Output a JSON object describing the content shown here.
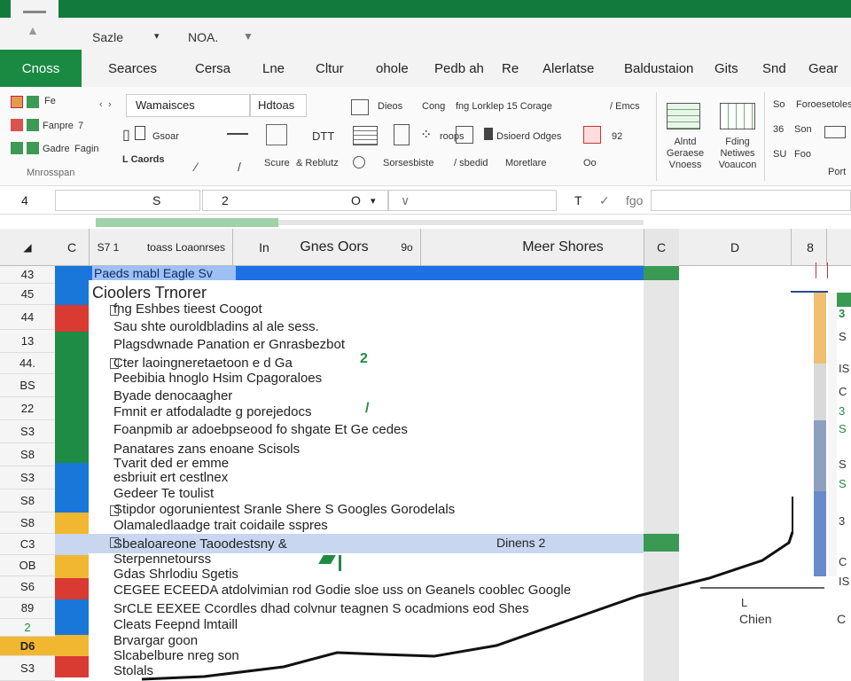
{
  "quick_access": {
    "item1": "Sazle",
    "item2": "NOA."
  },
  "tabs": {
    "active": "Cnoss",
    "items": [
      "Searces",
      "Cersa",
      "Lne",
      "Cltur",
      "ohole",
      "Pedb ah",
      "Re",
      "Alerlatse",
      "Baldustaion",
      "Gits",
      "Snd",
      "Gear"
    ]
  },
  "ribbon": {
    "g1": [
      "Fe",
      "Fanpre",
      "Gadre"
    ],
    "g1_caption": "Mnrosspan",
    "g1b": [
      "7",
      "Fagin"
    ],
    "field1": "Wamaisces",
    "field2": "Hdtoas",
    "row_a": [
      "Gsoar",
      "DTT",
      "Dieos",
      "Cong",
      "fng Lorklep 15 Corage",
      "/ Emcs"
    ],
    "row_a_sub": "roops",
    "row_b": [
      "Dsioerd Odges",
      "92"
    ],
    "row_c": [
      "L Caords",
      "Scure",
      "& Reblutz",
      "Sorsesbiste",
      "/ sbedid",
      "Moretlare",
      "Oo"
    ],
    "right_labels": [
      "Alntd Geraese Vnoess",
      "Fding Netiwes Voaucon"
    ],
    "far_right": [
      "Foroesetoless",
      "Son",
      "Foo",
      "Port"
    ],
    "small": [
      "So",
      "36",
      "SU"
    ]
  },
  "formula_bar": {
    "namebox": "4",
    "c1": "S",
    "c2": "2",
    "c3": "O",
    "c4": "T",
    "c5": "fgo"
  },
  "columns": {
    "a": "C",
    "b": "S7 1",
    "b2": "toass Loaonrses",
    "b3": "In",
    "c": "Gnes Oors",
    "c2": "9o",
    "d": "Meer Shores",
    "e": "C",
    "f": "D",
    "g": "8"
  },
  "rows": [
    "43",
    "45",
    "44",
    "13",
    "44.",
    "BS",
    "22",
    "S3",
    "S8",
    "S3",
    "S8",
    "S8",
    "C3",
    "OB",
    "S6",
    "89",
    "2",
    "D6",
    "S3"
  ],
  "colors": {
    "green": "#1e8c45",
    "blue": "#1877d8",
    "red": "#d93a32",
    "yellow": "#f2b731",
    "highlight": "#1f6fe6"
  },
  "header_bar_text": "Paeds mabl Eagle Sv",
  "list_title": "Cioolers Trnorer",
  "list": [
    "fng Eshbes tieest Coogot",
    "Sau shte ouroldbladins al ale sess.",
    "Plagsdwnade Panation er Gnrasbezbot",
    "Cter laoingneretaetoon e d Ga",
    "Peebibia hnoglo Hsim Cpagoraloes",
    "Byade denocaagher",
    "Fmnit er atfodaladte g porejedocs",
    "Foanpmib ar adoebpseood fo shgate Et Ge cedes",
    "Panatares zans enoane Scisols",
    "Tvarit ded er emme",
    "esbriuit ert cestlnex",
    "Gedeer Te toulist",
    "Stipdor ogorunientest Sranle Shere S Googles Gorodelals",
    "Olamaledlaadge trait coidaile sspres",
    "Sbealoareone Taoodestsny &",
    "Sterpennetourss",
    "Gdas Shrlodiu Sgetis",
    "CEGEE ECEEDA atdolvimian rod Godie sloe uss on Geanels cooblec Google",
    "SrCLE EEXEE Ccordles dhad colvnur teagnen S ocadmions eod Shes",
    "Cleats Feepnd lmtaill",
    "Brvargar goon",
    "Slcabelbure nreg son",
    "Stolals"
  ],
  "list_marks": [
    "2",
    "/"
  ],
  "highlight_row": {
    "text": "Sbealoareone Taoodestsny &",
    "right": "Dinens 2"
  },
  "chart_labels": {
    "l": "L",
    "chien": "Chien",
    "c": "C"
  },
  "panel_letters": [
    "3",
    "S",
    "IS",
    "C",
    "3",
    "S",
    "S",
    "S",
    "3",
    "C",
    "IS"
  ]
}
